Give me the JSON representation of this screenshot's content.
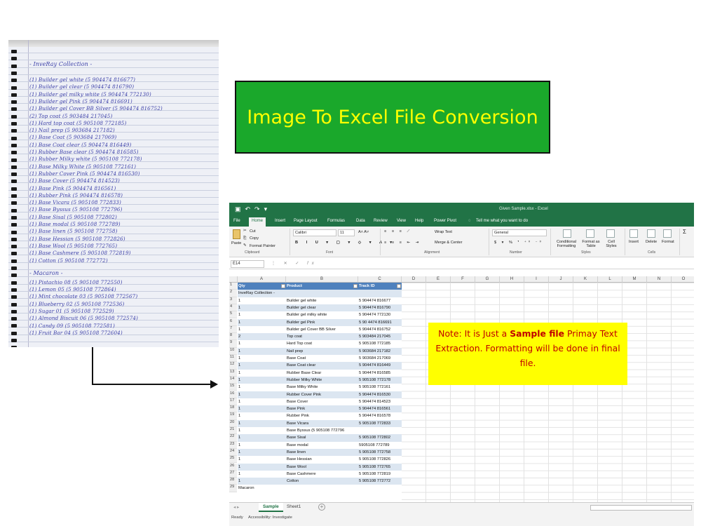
{
  "title_banner": "Image To Excel File Conversion",
  "notebook": {
    "heading": "- InveRay Collection -",
    "lines": [
      "(1) Builder gel white (5 904474 816677)",
      "(1) Builder gel clear (5 904474 816790)",
      "(1) Builder gel milky white (5 904474 772130)",
      "(1) Builder gel Pink (5 904474 816691)",
      "(1) Builder gel Cover BB Silver (5 904474 816752)",
      "(2) Top coat (5 903484 217045)",
      "(1) Hard top coat (5 905108 772185)",
      "(1) Nail prep (5 903684 217182)",
      "(1) Base Coat (5 903684 217069)",
      "(1) Base Coat clear (5 904474 816449)",
      "(1) Rubber Base clear (5 904474 816585)",
      "(1) Rubber Milky white (5 905108 772178)",
      "(1) Base Milky White (5 905108 772161)",
      "(1) Rubber Cover Pink (5 904474 816530)",
      "(1) Base Cover (5 904474 814523)",
      "(1) Base Pink (5 904474 816561)",
      "(1) Rubber Pink (5 904474 816578)",
      "(1) Base Vicara (5 905108 772833)",
      "(1) Base Byssus (5 905108 772796)",
      "(1) Base Sisal (5 905108 772802)",
      "(1) Base modal (5 905108 772789)",
      "(1) Base linen (5 905108 772758)",
      "(1) Base Hessian (5 905108 772826)",
      "(1) Base Wool (5 905108 772765)",
      "(1) Base Cashmere (5 905108 772819)",
      "(1) Cotton (5 905108 772772)"
    ],
    "heading2": "- Macaron -",
    "lines2": [
      "(1) Pistachio 08 (5 905108 772550)",
      "(1) Lemon 05 (5 905108 772864)",
      "(1) Mint chocolate 03 (5 905108 772567)",
      "(1) Blueberry 02 (5 905108 772536)",
      "(1) Sugar 01 (5 905108 772529)",
      "(1) Almond Biscuit 06 (5 905108 772574)",
      "(1) Candy 09 (5 905108 772581)",
      "(1) Fruit Bar 04 (5 905108 772604)"
    ]
  },
  "excel": {
    "window_title": "Given Sample.xlsx - Excel",
    "menu": [
      "File",
      "Home",
      "Insert",
      "Page Layout",
      "Formulas",
      "Data",
      "Review",
      "View",
      "Help",
      "Power Pivot",
      "Tell me what you want to do"
    ],
    "ribbon": {
      "cut": "Cut",
      "copy": "Copy",
      "format_painter": "Format Painter",
      "paste": "Paste",
      "clipboard": "Clipboard",
      "font_name": "Calibri",
      "font_size": "11",
      "font_group": "Font",
      "wrap_text": "Wrap Text",
      "merge_center": "Merge & Center",
      "alignment": "Alignment",
      "number_format": "General",
      "number": "Number",
      "conditional_formatting": "Conditional Formatting",
      "format_as_table": "Format as Table",
      "cell_styles": "Cell Styles",
      "styles": "Styles",
      "insert": "Insert",
      "delete": "Delete",
      "format": "Format",
      "cells": "Cells"
    },
    "name_box": "E14",
    "fx": "fx",
    "columns": [
      "A",
      "B",
      "C",
      "D",
      "E",
      "F",
      "G",
      "H",
      "I",
      "J",
      "K",
      "L",
      "M",
      "N",
      "O"
    ],
    "header": [
      "Qty",
      "Product",
      "Track ID"
    ],
    "rows": [
      [
        "InveRay Collection -",
        "",
        ""
      ],
      [
        "1",
        "Builder gel white",
        "5 904474 816677"
      ],
      [
        "1",
        "Builder gel clear",
        "5 904474 816790"
      ],
      [
        "1",
        "Builder gel milky white",
        "5 904474 772130"
      ],
      [
        "1",
        "Builder gel Pink",
        "5 90 4474 816691"
      ],
      [
        "1",
        "Builder gel Cover BB Silver",
        "5 904474 816752"
      ],
      [
        "2",
        "Top coat",
        "5 903484 217045"
      ],
      [
        "1",
        "Hard Top coat",
        "5 905108 772185"
      ],
      [
        "1",
        "Nail prep",
        "5 903684 217182"
      ],
      [
        "1",
        "Base Coat",
        "5 903684 217069"
      ],
      [
        "1",
        "Base Coat clear",
        "5 904474 816449"
      ],
      [
        "1",
        "Rubber Base Clear",
        "5 904474 816585"
      ],
      [
        "1",
        "Rubber Milky White",
        "5 905108 772178"
      ],
      [
        "1",
        "Base Milky White",
        "5 905108 772161"
      ],
      [
        "1",
        "Rubber Cover Pink",
        "5 904474 816530"
      ],
      [
        "1",
        "Base Cover",
        "5 904474 814523"
      ],
      [
        "1",
        "Base Pink",
        "5 904474 816561"
      ],
      [
        "1",
        "Rubber Pink",
        "5 904474 816578"
      ],
      [
        "1",
        "Base Vicara",
        "5 905108 772833"
      ],
      [
        "1",
        "Base Byssus (5 905108 772796",
        ""
      ],
      [
        "1",
        "Base Sisal",
        "5 905108 772802"
      ],
      [
        "1",
        "Base modal",
        "5905108 772789"
      ],
      [
        "1",
        "Base linen",
        "5 905108 772758"
      ],
      [
        "1",
        "Base Hessian",
        "5 905108 772826"
      ],
      [
        "1",
        "Base Wool",
        "5 905108 772765"
      ],
      [
        "1",
        "Base Cashmere",
        "5 905108 772819"
      ],
      [
        "1",
        "Cotton",
        "5 905108 772772"
      ],
      [
        "Macaron",
        "",
        ""
      ]
    ],
    "sheet_tabs": [
      "Sample",
      "Sheet1"
    ],
    "status": "Ready",
    "accessibility": "Accessibility: Investigate"
  },
  "note": {
    "prefix": "Note: It is Just a ",
    "bold": "Sample file",
    "suffix": " Primay Text Extraction. Formatting will be done in final file."
  }
}
